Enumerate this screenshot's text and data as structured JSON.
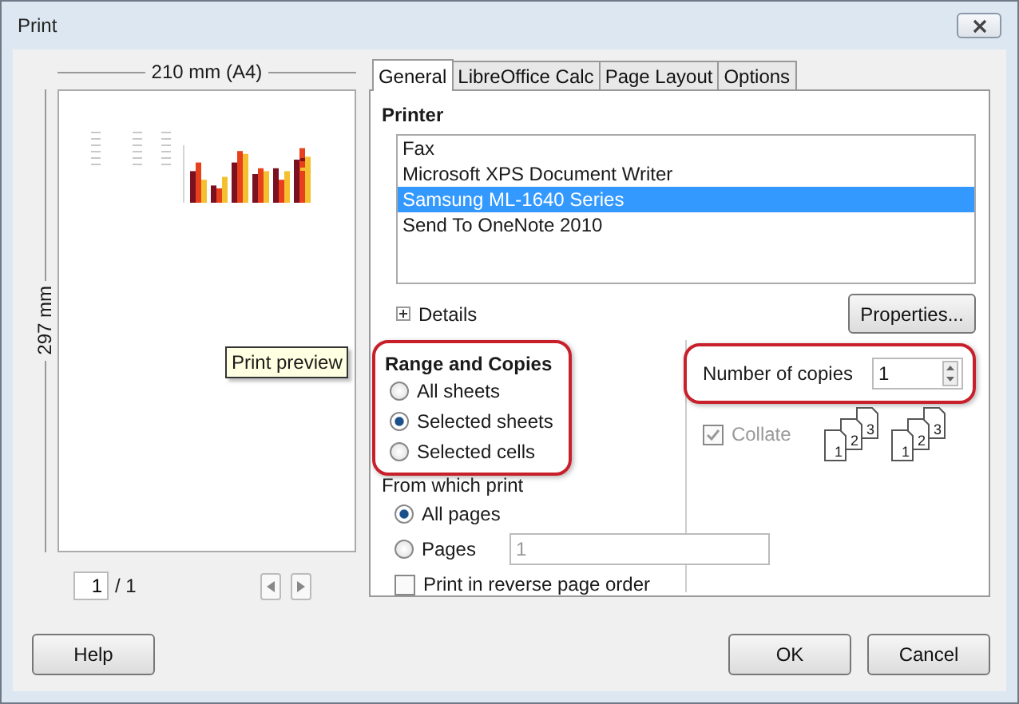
{
  "window": {
    "title": "Print"
  },
  "preview": {
    "width_label": "210 mm (A4)",
    "height_label": "297 mm",
    "tooltip": "Print preview",
    "page_field": "1",
    "page_total": "/ 1"
  },
  "tabs": [
    {
      "label": "General",
      "selected": true
    },
    {
      "label": "LibreOffice Calc",
      "selected": false
    },
    {
      "label": "Page Layout",
      "selected": false
    },
    {
      "label": "Options",
      "selected": false
    }
  ],
  "printer": {
    "heading": "Printer",
    "items": [
      {
        "name": "Fax",
        "selected": false
      },
      {
        "name": "Microsoft XPS Document Writer",
        "selected": false
      },
      {
        "name": "Samsung ML-1640 Series",
        "selected": true
      },
      {
        "name": "Send To OneNote 2010",
        "selected": false
      }
    ],
    "details": "Details",
    "details_expanded": false,
    "properties_button": "Properties..."
  },
  "range": {
    "heading": "Range and Copies",
    "highlighted": true,
    "options": [
      {
        "label": "All sheets",
        "selected": false
      },
      {
        "label": "Selected sheets",
        "selected": true
      },
      {
        "label": "Selected cells",
        "selected": false
      }
    ]
  },
  "from_which": {
    "heading": "From which print",
    "options": [
      {
        "label": "All pages",
        "selected": true
      },
      {
        "label": "Pages",
        "selected": false,
        "field": "1"
      }
    ],
    "reverse": {
      "label": "Print in reverse page order",
      "checked": false
    }
  },
  "copies": {
    "label": "Number of copies",
    "value": "1",
    "highlighted": true,
    "collate": {
      "label": "Collate",
      "checked": true,
      "disabled": true
    },
    "collate_stacks": [
      [
        "1",
        "2",
        "3"
      ],
      [
        "1",
        "2",
        "3"
      ]
    ]
  },
  "buttons": {
    "help": "Help",
    "ok": "OK",
    "cancel": "Cancel"
  }
}
